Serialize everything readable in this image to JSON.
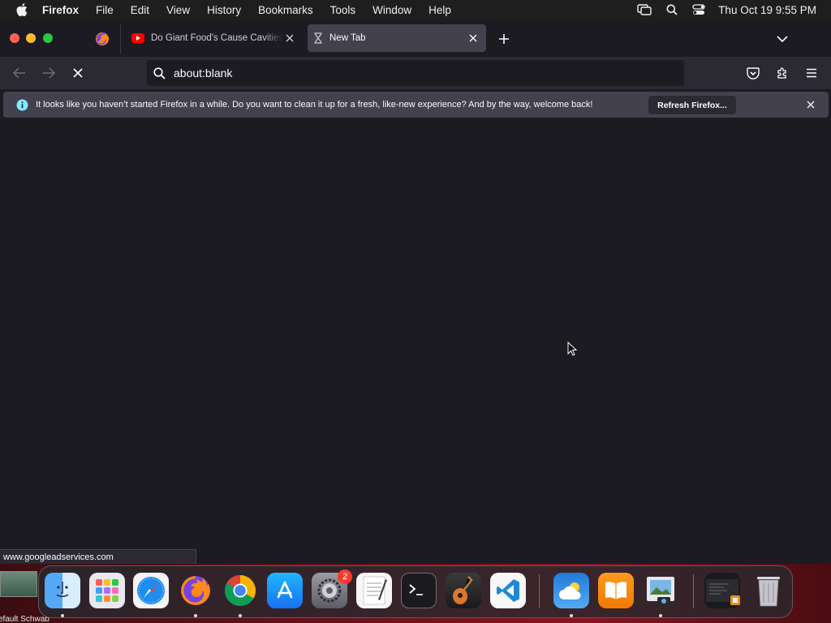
{
  "menubar": {
    "app": "Firefox",
    "items": [
      "File",
      "Edit",
      "View",
      "History",
      "Bookmarks",
      "Tools",
      "Window",
      "Help"
    ],
    "clock": "Thu Oct 19  9:55 PM"
  },
  "tabs": [
    {
      "title": "Do Giant Food's Cause Cavities",
      "favicon": "youtube-icon"
    },
    {
      "title": "New Tab",
      "favicon": "loading-hourglass-icon"
    }
  ],
  "urlbar": {
    "value": "about:blank"
  },
  "notification": {
    "message": "It looks like you haven’t started Firefox in a while. Do you want to clean it up for a fresh, like-new experience? And by the way, welcome back!",
    "button": "Refresh Firefox..."
  },
  "status_url": "www.googleadservices.com",
  "dock": {
    "settings_badge": "2",
    "apps": [
      "Finder",
      "Launchpad",
      "Safari",
      "Firefox",
      "Chrome",
      "App Store",
      "System Settings",
      "TextEdit",
      "Terminal",
      "GarageBand",
      "Visual Studio Code",
      "Weather",
      "Books",
      "Preview",
      "Screen Recording",
      "Trash"
    ]
  },
  "desktop_label": "efault  Schwab"
}
